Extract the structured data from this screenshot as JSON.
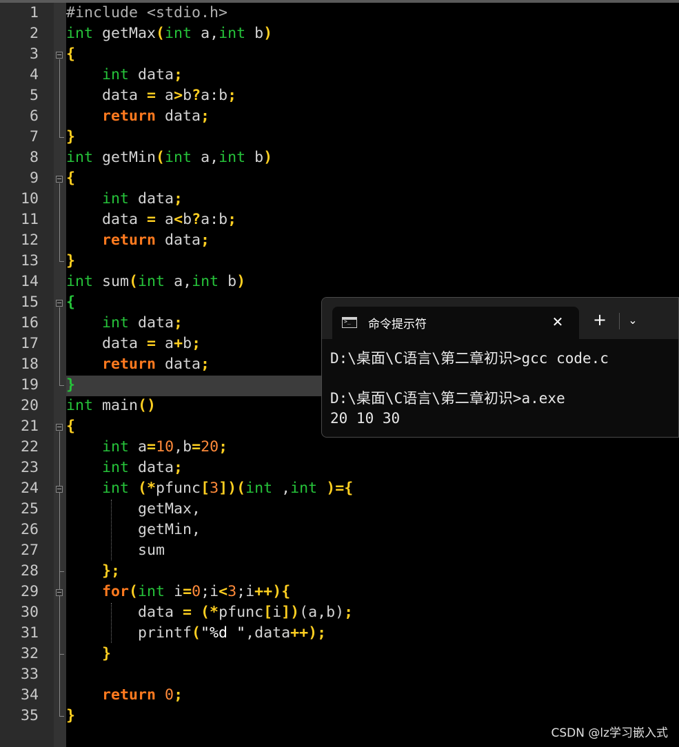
{
  "editor": {
    "line_numbers": [
      "1",
      "2",
      "3",
      "4",
      "5",
      "6",
      "7",
      "8",
      "9",
      "10",
      "11",
      "12",
      "13",
      "14",
      "15",
      "16",
      "17",
      "18",
      "19",
      "20",
      "21",
      "22",
      "23",
      "24",
      "25",
      "26",
      "27",
      "28",
      "29",
      "30",
      "31",
      "32",
      "33",
      "34",
      "35"
    ],
    "code": {
      "l1_a": "#include <stdio.h>",
      "kw_int": "int",
      "kw_return": "return",
      "kw_for": "for",
      "l2_fn": " getMax",
      "l8_fn": " getMin",
      "l14_fn": " sum",
      "l20_fn": " main",
      "params_a": " a,",
      "params_b": " b",
      "lparen": "(",
      "rparen": ")",
      "lbrace": "{",
      "rbrace": "}",
      "indent": "    ",
      "indent2": "        ",
      "data_decl": " data",
      "semi": ";",
      "data": "data ",
      "eq": "=",
      "a_sp": " a",
      "gt": ">",
      "lt": "<",
      "plus": "+",
      "b": "b",
      "qm": "?",
      "ab_tail": "a:b",
      "sum_tail": "b",
      "ret_data": " data",
      "l22_a": " a",
      "n10": "10",
      "comma_b": ",b",
      "n20": "20",
      "l24_star": " (*",
      "pfunc": "pfunc",
      "lbr": "[",
      "n3": "3",
      "rbr": "]",
      "int_sp": "int ",
      "comma": ",",
      "eq_brace": "={",
      "l25": "getMax,",
      "l26": "getMin,",
      "l27": "sum",
      "l28": "};",
      "i_sp": " i",
      "n0": "0",
      "semi_i": ";i",
      "semi_ipp": ";i",
      "pp": "++",
      "rparen_brace": "){",
      "l30_data": "data ",
      "l30_mid": " (*",
      "l30_i": "i",
      "l30_ab": "(a,b)",
      "l31_printf": "printf",
      "l31_str": "\"%d \"",
      "l31_data": ",data",
      "ret_sp": " ",
      "zero": "0"
    }
  },
  "terminal": {
    "tab_title": "命令提示符",
    "close_glyph": "✕",
    "add_glyph": "+",
    "dropdown_glyph": "⌄",
    "lines": [
      "D:\\桌面\\C语言\\第二章初识>gcc code.c",
      "",
      "D:\\桌面\\C语言\\第二章初识>a.exe",
      "20 10 30"
    ]
  },
  "watermark": "CSDN @lz学习嵌入式"
}
